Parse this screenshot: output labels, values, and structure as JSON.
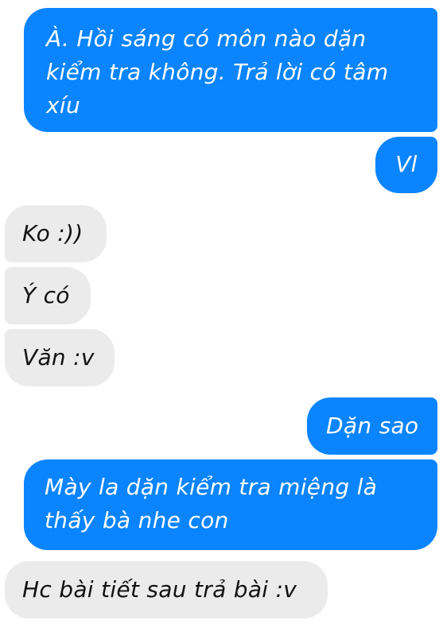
{
  "conversation": {
    "messages": [
      {
        "sender": "me",
        "text": "À. Hồi sáng có môn nào dặn kiểm tra không. Trả lời có tâm xíu"
      },
      {
        "sender": "me",
        "text": "Vl"
      },
      {
        "sender": "them",
        "text": "Ko :))"
      },
      {
        "sender": "them",
        "text": "Ý có"
      },
      {
        "sender": "them",
        "text": "Văn :v"
      },
      {
        "sender": "me",
        "text": "Dặn sao"
      },
      {
        "sender": "me",
        "text": "Mày la dặn kiểm tra miệng là thấy bà nhe con"
      },
      {
        "sender": "them",
        "text": "Hc bài tiết sau trả bài :v"
      }
    ]
  },
  "colors": {
    "outgoing_bubble": "#0a84ff",
    "incoming_bubble": "#ebebeb",
    "outgoing_text": "#ffffff",
    "incoming_text": "#111111",
    "background": "#ffffff"
  }
}
